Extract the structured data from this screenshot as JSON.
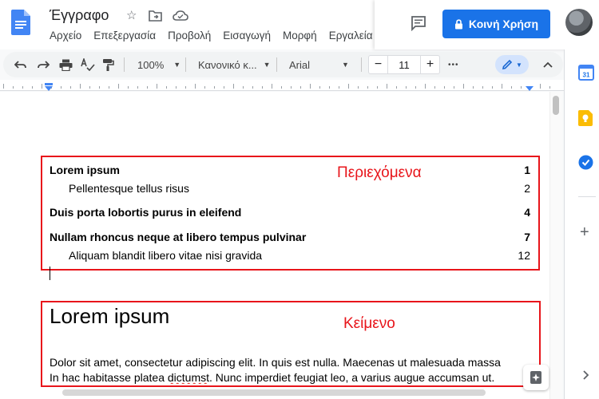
{
  "header": {
    "title": "Έγγραφο",
    "menu": [
      "Αρχείο",
      "Επεξεργασία",
      "Προβολή",
      "Εισαγωγή",
      "Μορφή",
      "Εργαλεία"
    ],
    "share_label": "Κοινή Χρήση"
  },
  "toolbar": {
    "zoom": "100%",
    "style": "Κανονικό κ...",
    "font": "Arial",
    "font_size": "11",
    "minus": "−",
    "plus": "+",
    "more": "•••"
  },
  "toc": {
    "annotation": "Περιεχόμενα",
    "entries": [
      {
        "text": "Lorem ipsum",
        "page": "1",
        "level": 1
      },
      {
        "text": "Pellentesque tellus risus",
        "page": "2",
        "level": 2
      },
      {
        "text": "Duis porta lobortis purus in eleifend",
        "page": "4",
        "level": 1
      },
      {
        "text": "Nullam rhoncus neque at libero tempus pulvinar",
        "page": "7",
        "level": 1
      },
      {
        "text": "Aliquam blandit libero vitae nisi gravida",
        "page": "12",
        "level": 2
      }
    ]
  },
  "body": {
    "annotation": "Κείμενο",
    "heading": "Lorem ipsum",
    "line1": "Dolor sit amet, consectetur adipiscing elit. In quis est nulla. Maecenas ut malesuada massa",
    "line2_a": "In hac habitasse platea ",
    "line2_misspelled": "dictumst",
    "line2_b": ". Nunc imperdiet feugiat leo, a varius augue accumsan ut."
  },
  "colors": {
    "accent": "#1a73e8",
    "annotation_red": "#e8151b"
  }
}
